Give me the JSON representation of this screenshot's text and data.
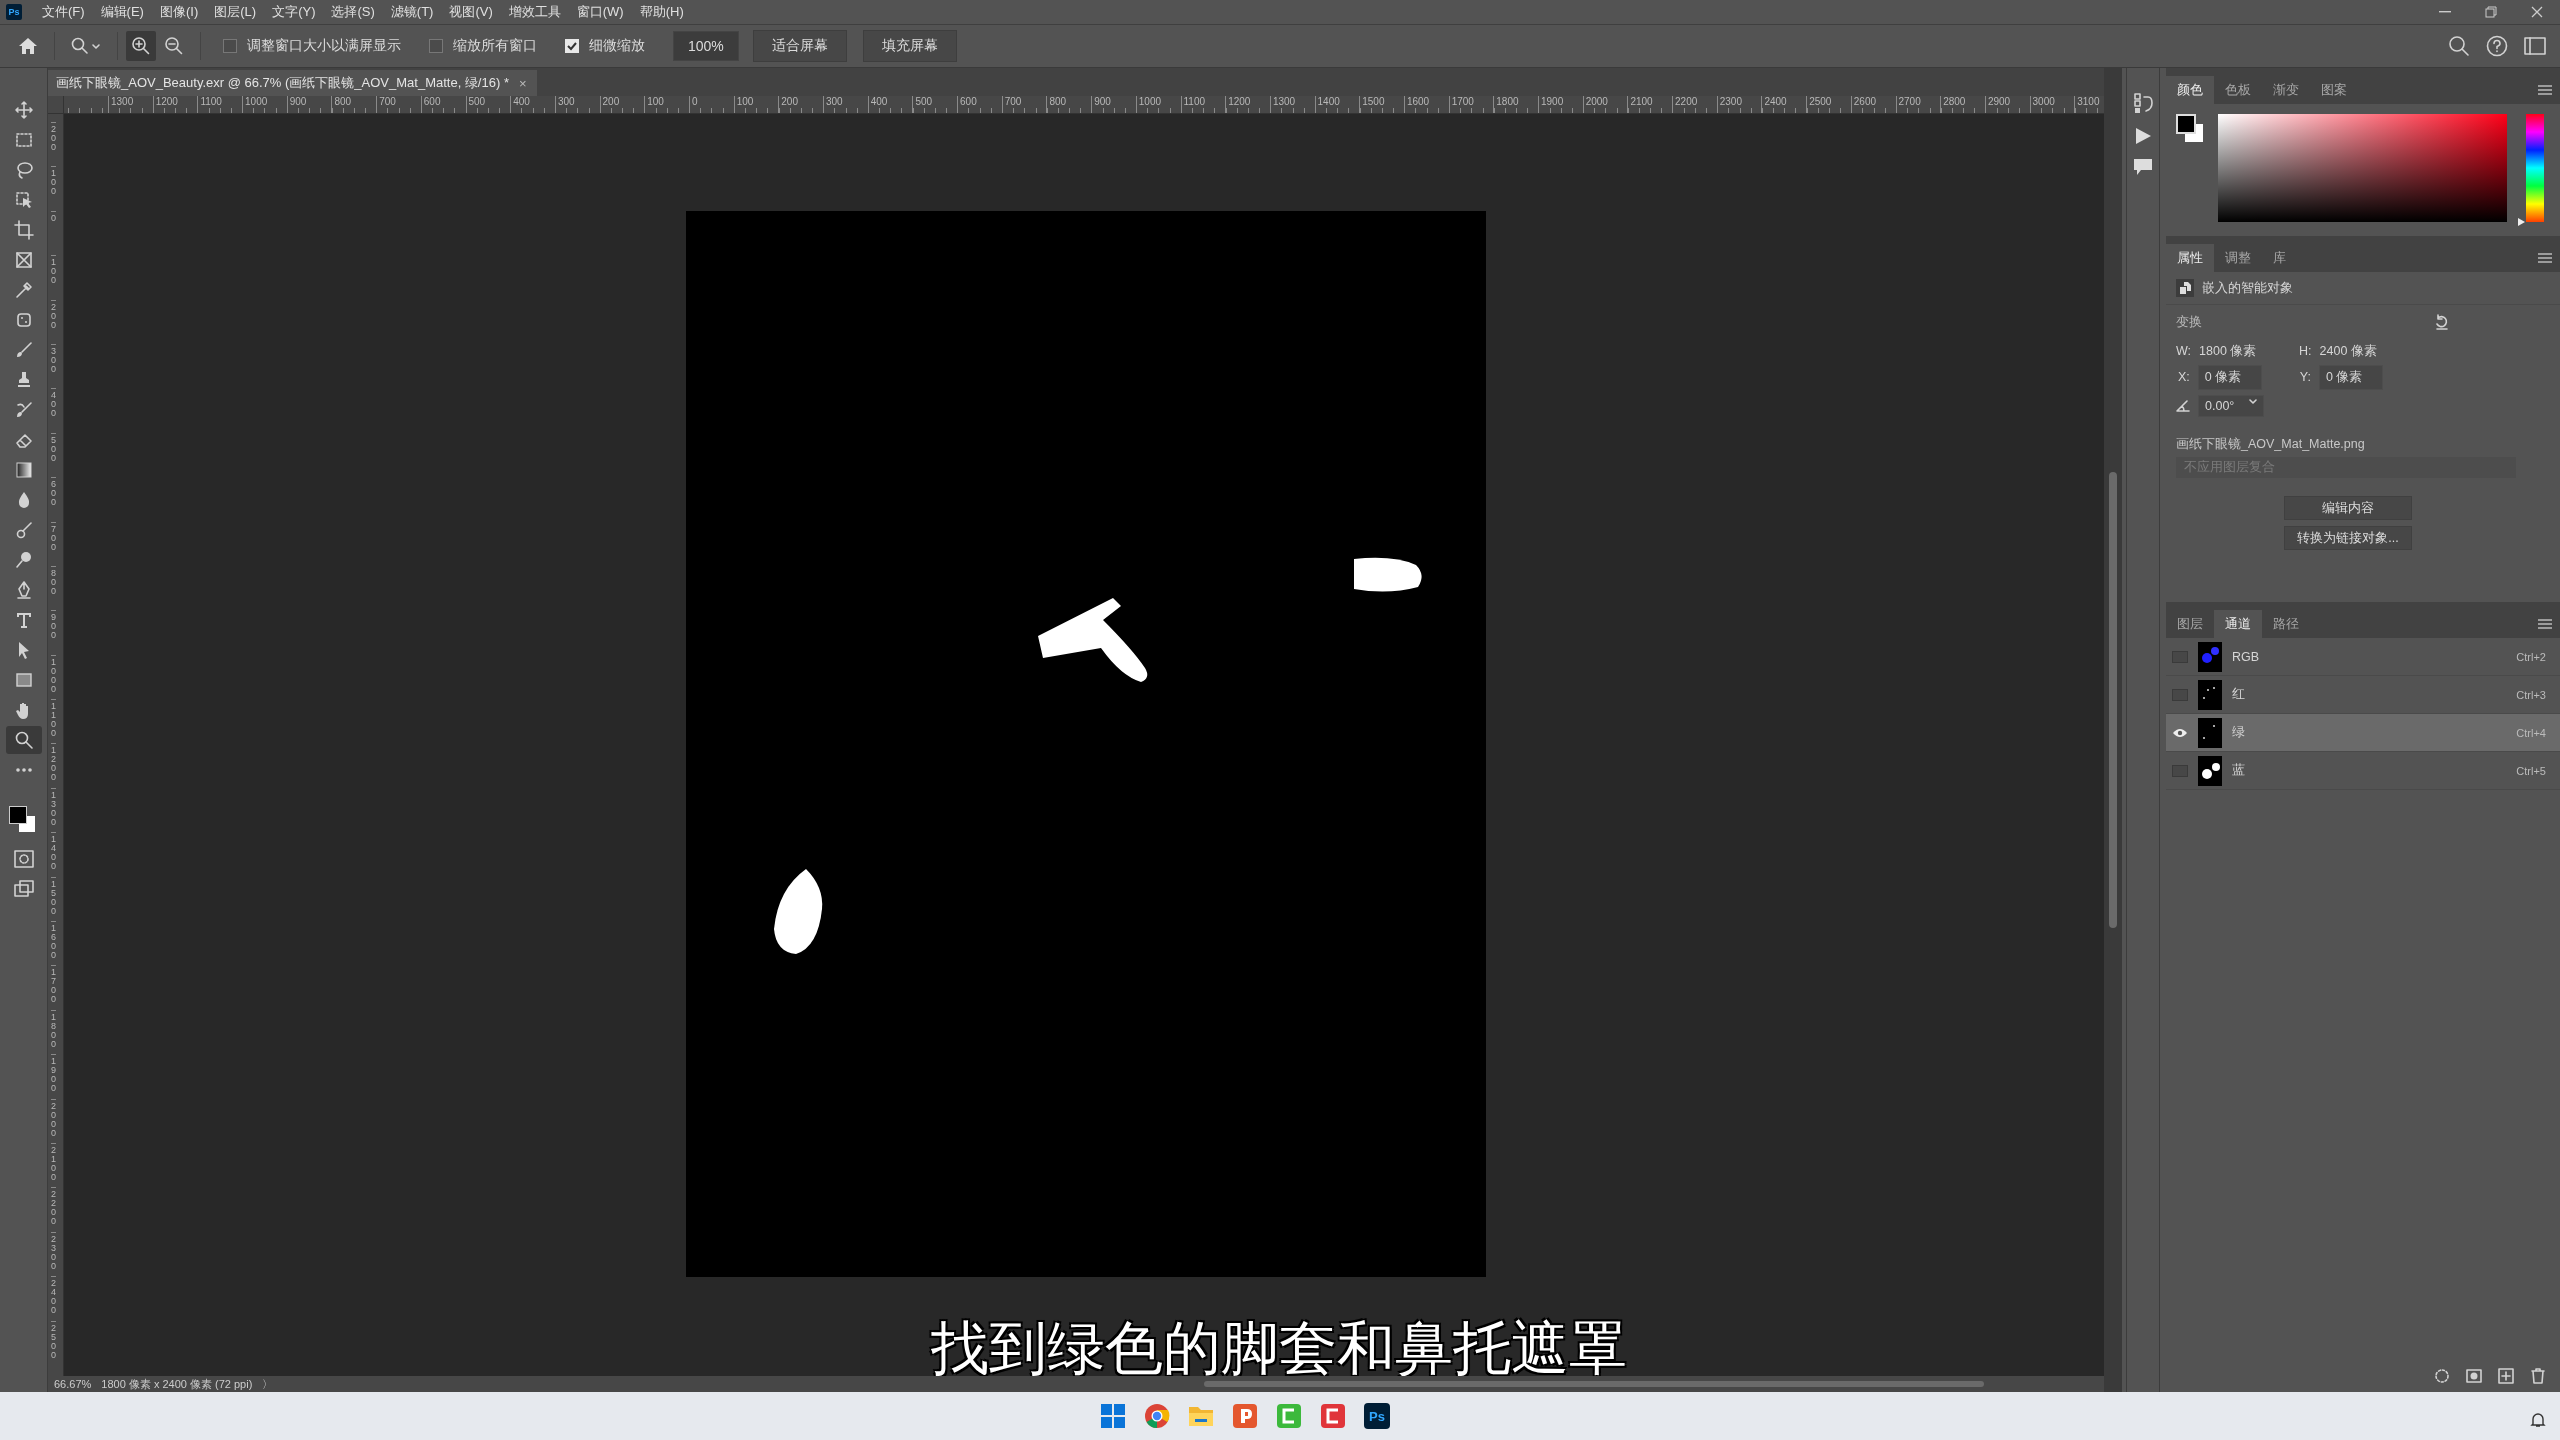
{
  "menu_bar": {
    "app_logo": "Ps",
    "items": [
      "文件(F)",
      "编辑(E)",
      "图像(I)",
      "图层(L)",
      "文字(Y)",
      "选择(S)",
      "滤镜(T)",
      "视图(V)",
      "增效工具",
      "窗口(W)",
      "帮助(H)"
    ]
  },
  "options_bar": {
    "checkboxes": [
      {
        "label": "调整窗口大小以满屏显示",
        "checked": false
      },
      {
        "label": "缩放所有窗口",
        "checked": false
      },
      {
        "label": "细微缩放",
        "checked": true
      }
    ],
    "zoom_value": "100%",
    "buttons": [
      "适合屏幕",
      "填充屏幕"
    ]
  },
  "document_tab": {
    "title": "画纸下眼镜_AOV_Beauty.exr @ 66.7% (画纸下眼镜_AOV_Mat_Matte, 绿/16) *",
    "close": "×"
  },
  "tools": [
    {
      "kind": "move",
      "selected": false
    },
    {
      "kind": "marquee",
      "selected": false
    },
    {
      "kind": "lasso",
      "selected": false
    },
    {
      "kind": "object-select",
      "selected": false
    },
    {
      "kind": "crop",
      "selected": false
    },
    {
      "kind": "frame",
      "selected": false
    },
    {
      "kind": "eyedropper",
      "selected": false
    },
    {
      "kind": "healing",
      "selected": false
    },
    {
      "kind": "brush",
      "selected": false
    },
    {
      "kind": "stamp",
      "selected": false
    },
    {
      "kind": "history-brush",
      "selected": false
    },
    {
      "kind": "eraser",
      "selected": false
    },
    {
      "kind": "gradient",
      "selected": false
    },
    {
      "kind": "blur",
      "selected": false
    },
    {
      "kind": "mixer",
      "selected": false
    },
    {
      "kind": "dodge",
      "selected": false
    },
    {
      "kind": "pen",
      "selected": false
    },
    {
      "kind": "type",
      "selected": false
    },
    {
      "kind": "path-select",
      "selected": false
    },
    {
      "kind": "rectangle",
      "selected": false
    },
    {
      "kind": "hand",
      "selected": false
    },
    {
      "kind": "zoom",
      "selected": true
    },
    {
      "kind": "more",
      "selected": false
    }
  ],
  "rulers": {
    "horizontal": [
      "1300",
      "1200",
      "1100",
      "1000",
      "900",
      "800",
      "700",
      "600",
      "500",
      "400",
      "300",
      "200",
      "100",
      "0",
      "100",
      "200",
      "300",
      "400",
      "500",
      "600",
      "700",
      "800",
      "900",
      "1000",
      "1100",
      "1200",
      "1300",
      "1400",
      "1500",
      "1600",
      "1700",
      "1800",
      "1900",
      "2000",
      "2100",
      "2200",
      "2300",
      "2400",
      "2500",
      "2600",
      "2700",
      "2800",
      "2900",
      "3000",
      "3100"
    ],
    "vertical": [
      "200",
      "100",
      "0",
      "100",
      "200",
      "300",
      "400",
      "500",
      "600",
      "700",
      "800",
      "900",
      "1000",
      "1100",
      "1200",
      "1300",
      "1400",
      "1500",
      "1600",
      "1700",
      "1800",
      "1900",
      "2000",
      "2100",
      "2200",
      "2300",
      "2400",
      "2500"
    ]
  },
  "caption": "找到绿色的脚套和鼻托遮罩",
  "status_bar": {
    "zoom": "66.67%",
    "doc_info": "1800 像素 x 2400 像素 (72 ppi)",
    "arrow": "〉"
  },
  "color_panel": {
    "hue_slider": {
      "level": 0
    },
    "tabs": [
      {
        "label": "颜色",
        "selected": true
      },
      {
        "label": "色板",
        "selected": false
      },
      {
        "label": "渐变",
        "selected": false
      },
      {
        "label": "图案",
        "selected": false
      }
    ]
  },
  "properties_panel": {
    "tabs": [
      {
        "label": "属性",
        "selected": true
      },
      {
        "label": "调整",
        "selected": false
      },
      {
        "label": "库",
        "selected": false
      }
    ],
    "object_type": "嵌入的智能对象",
    "section": "变换",
    "w_label": "W:",
    "w": "1800 像素",
    "h_label": "H:",
    "h": "2400 像素",
    "x_label": "X:",
    "x": "0 像素",
    "y_label": "Y:",
    "y": "0 像素",
    "angle": "0.00°",
    "file_name": "画纸下眼镜_AOV_Mat_Matte.png",
    "layer_comp": "不应用图层复合",
    "buttons": [
      "编辑内容",
      "转换为链接对象..."
    ]
  },
  "channels_panel": {
    "tabs": [
      {
        "label": "图层",
        "selected": false
      },
      {
        "label": "通道",
        "selected": true
      },
      {
        "label": "路径",
        "selected": false
      }
    ],
    "channels": [
      {
        "name": "RGB",
        "shortcut": "Ctrl+2",
        "visible": false,
        "selected": false
      },
      {
        "name": "红",
        "shortcut": "Ctrl+3",
        "visible": false,
        "selected": false
      },
      {
        "name": "绿",
        "shortcut": "Ctrl+4",
        "visible": true,
        "selected": true
      },
      {
        "name": "蓝",
        "shortcut": "Ctrl+5",
        "visible": false,
        "selected": false
      }
    ]
  },
  "taskbar": {
    "ps_label": "Ps"
  }
}
